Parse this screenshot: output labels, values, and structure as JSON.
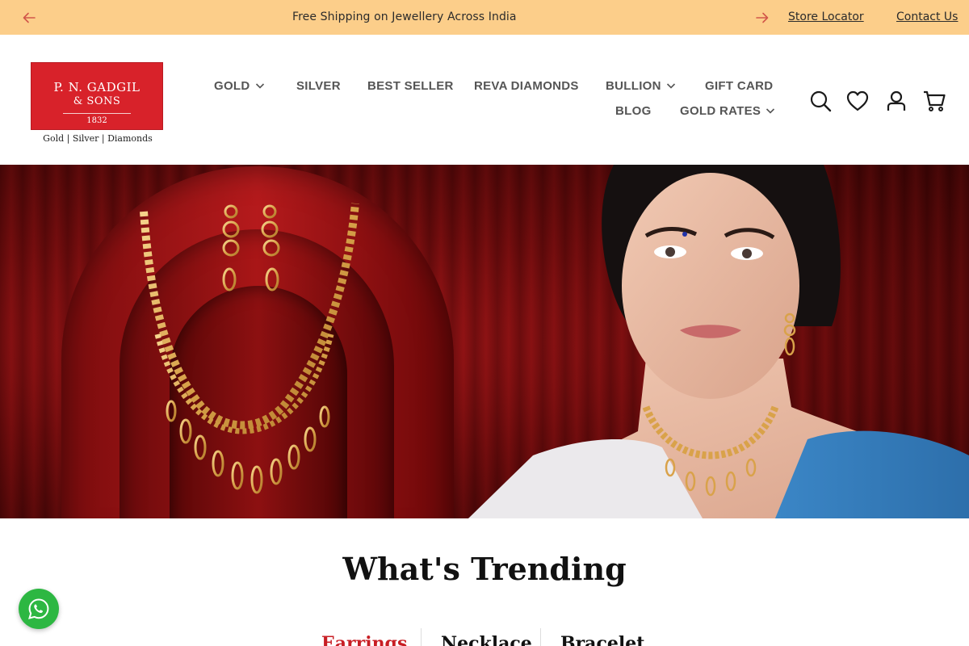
{
  "announcement": {
    "message": "Free Shipping on Jewellery Across India",
    "store_locator": "Store Locator",
    "contact_us": "Contact Us"
  },
  "logo": {
    "line1": "P. N. GADGIL",
    "line2": "& SONS",
    "year": "1832",
    "tagline": "Gold | Silver | Diamonds"
  },
  "nav": {
    "items": [
      {
        "label": "GOLD",
        "has_dropdown": true
      },
      {
        "label": "SILVER",
        "has_dropdown": false
      },
      {
        "label": "BEST SELLER",
        "has_dropdown": false
      },
      {
        "label": "REVA DIAMONDS",
        "has_dropdown": false
      },
      {
        "label": "BULLION",
        "has_dropdown": true
      },
      {
        "label": "GIFT CARD",
        "has_dropdown": false
      },
      {
        "label": "BLOG",
        "has_dropdown": false
      },
      {
        "label": "GOLD RATES",
        "has_dropdown": true
      }
    ]
  },
  "header_icons": [
    "search-icon",
    "wishlist-heart-icon",
    "account-icon",
    "cart-icon"
  ],
  "trending": {
    "title": "What's Trending",
    "tabs": [
      {
        "label": "Earrings",
        "active": true
      },
      {
        "label": "Necklace",
        "active": false
      },
      {
        "label": "Bracelet",
        "active": false
      }
    ]
  },
  "colors": {
    "announcement_bg": "#fcce8a",
    "brand_red": "#d8222a",
    "active_tab": "#c81e24",
    "whatsapp": "#2db742"
  }
}
